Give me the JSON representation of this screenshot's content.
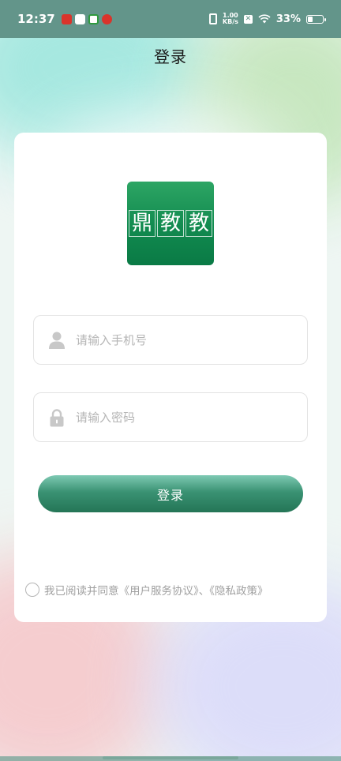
{
  "status_bar": {
    "time": "12:37",
    "notification_icons": [
      "app-icon-1",
      "message-icon",
      "app-icon-3",
      "app-icon-4"
    ],
    "net_speed_value": "1.00",
    "net_speed_unit": "KB/s",
    "battery_percent": "33%",
    "battery_level": 0.33
  },
  "header": {
    "title": "登录"
  },
  "logo": {
    "chars": [
      "鼎",
      "教",
      "教"
    ]
  },
  "form": {
    "phone_placeholder": "请输入手机号",
    "password_placeholder": "请输入密码",
    "login_label": "登录"
  },
  "agreement": {
    "text": "我已阅读并同意《用户服务协议》、《隐私政策》",
    "checked": false
  },
  "colors": {
    "accent": "#2f8a68",
    "status_bar": "#63958a",
    "logo_green": "#118a4f"
  }
}
